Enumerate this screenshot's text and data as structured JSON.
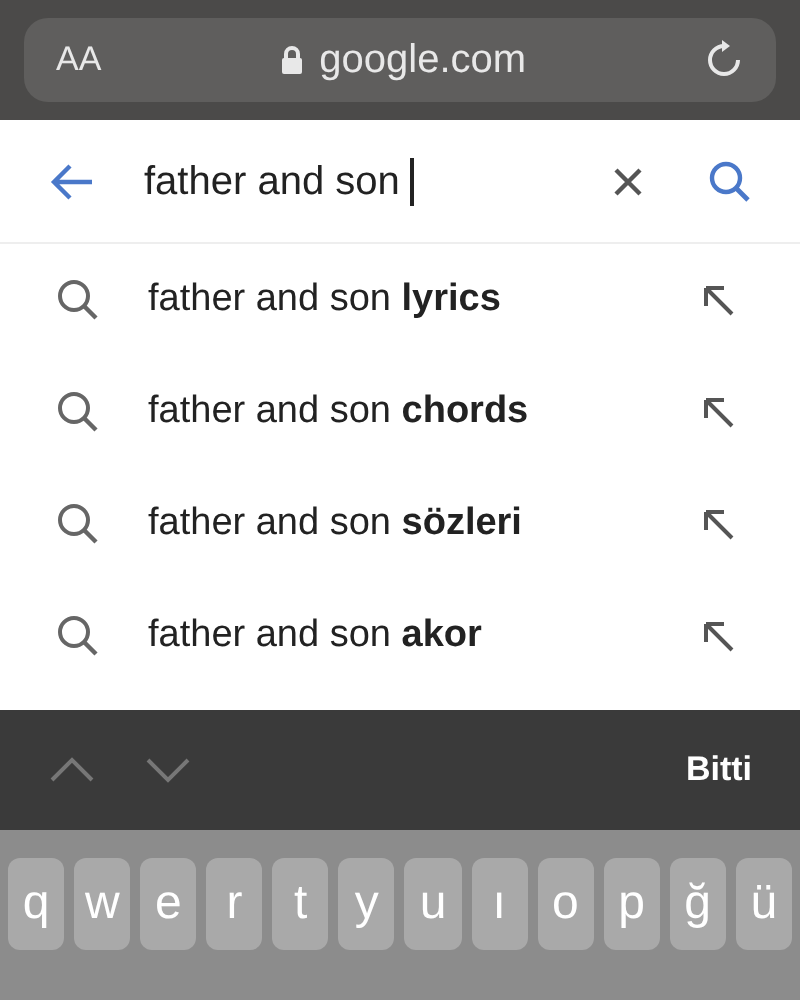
{
  "address_bar": {
    "text_size_button": "AA",
    "url": "google.com"
  },
  "search": {
    "value": "father and son "
  },
  "suggestions": [
    {
      "text": "father and son **lyrics**"
    },
    {
      "text": "father and son **chords**"
    },
    {
      "text": "father and son **sözleri**"
    },
    {
      "text": "father and son **akor**"
    }
  ],
  "keyboard_toolbar": {
    "done": "Bitti"
  },
  "keyboard": {
    "keys": [
      "q",
      "w",
      "e",
      "r",
      "t",
      "y",
      "u",
      "ı",
      "o",
      "p",
      "ğ",
      "ü"
    ]
  }
}
